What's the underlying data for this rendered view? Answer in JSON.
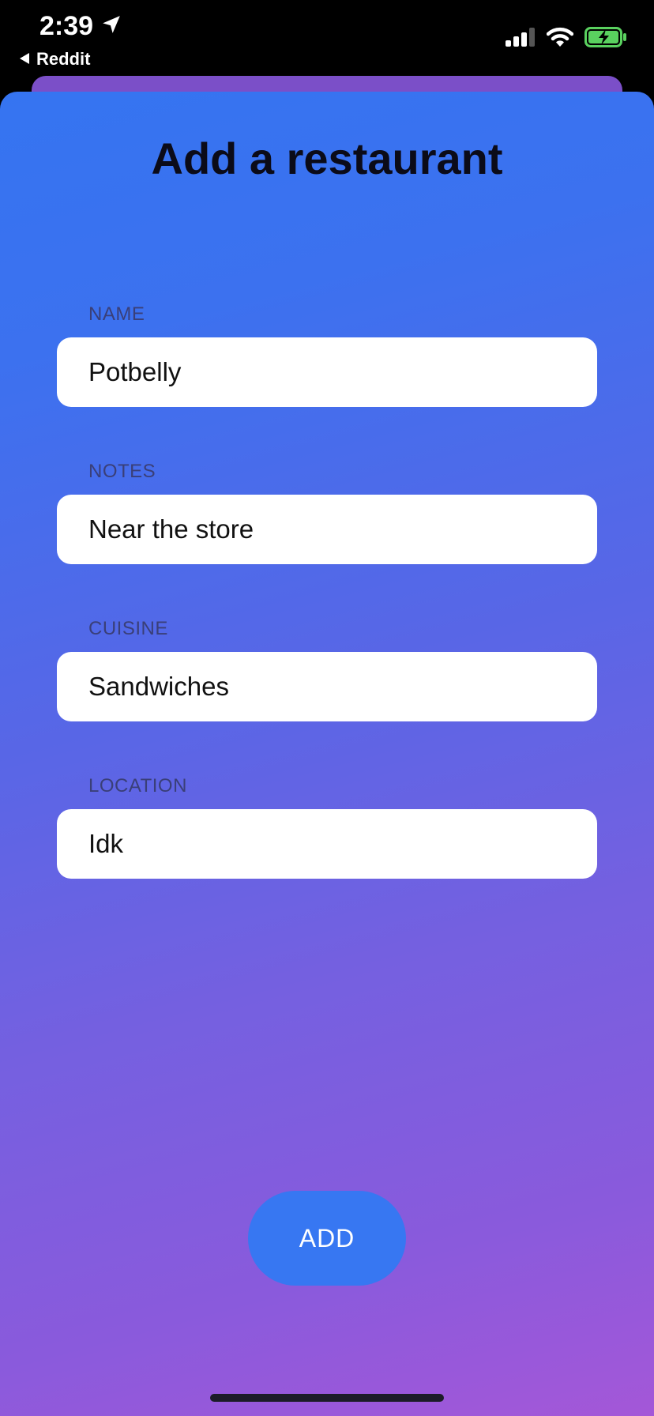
{
  "status_bar": {
    "time": "2:39",
    "back_app": "Reddit",
    "icons": [
      "location-arrow-icon",
      "signal-icon",
      "wifi-icon",
      "battery-charging-icon"
    ],
    "battery_color": "#5ad15f"
  },
  "sheet": {
    "title": "Add a restaurant",
    "fields": [
      {
        "label": "NAME",
        "value": "Potbelly"
      },
      {
        "label": "NOTES",
        "value": "Near the store"
      },
      {
        "label": "CUISINE",
        "value": "Sandwiches"
      },
      {
        "label": "LOCATION",
        "value": "Idk"
      }
    ],
    "add_label": "ADD"
  },
  "colors": {
    "gradient_start": "#3574f1",
    "gradient_end": "#a457d8",
    "button": "#3777f2"
  }
}
